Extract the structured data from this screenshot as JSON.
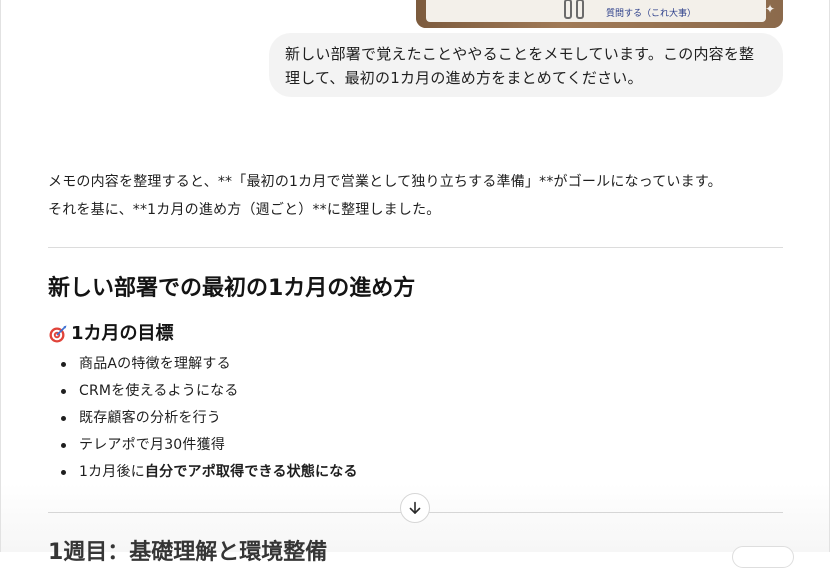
{
  "attachment": {
    "handwriting_text": "質問する（これ大事）"
  },
  "user_message": {
    "line1": "新しい部署で覚えたことややることをメモしています。この内容を整",
    "line2": "理して、最初の1カ月の進め方をまとめてください。"
  },
  "assistant": {
    "intro_line1": "メモの内容を整理すると、**「最初の1カ月で営業として独り立ちする準備」**がゴールになっています。",
    "intro_line2": "それを基に、**1カ月の進め方（週ごと）**に整理しました。",
    "title": "新しい部署での最初の1カ月の進め方",
    "goal_heading": "1カ月の目標",
    "goal_icon": "target-icon",
    "goals": [
      "商品Aの特徴を理解する",
      "CRMを使えるようになる",
      "既存顧客の分析を行う",
      "テレアポで月30件獲得"
    ],
    "goal_last_prefix": "1カ月後に",
    "goal_last_bold": "自分でアポ取得できる状態になる",
    "next_heading_partial": "1週目：基礎理解と環境整備"
  },
  "scroll_button_icon": "arrow-down-icon"
}
